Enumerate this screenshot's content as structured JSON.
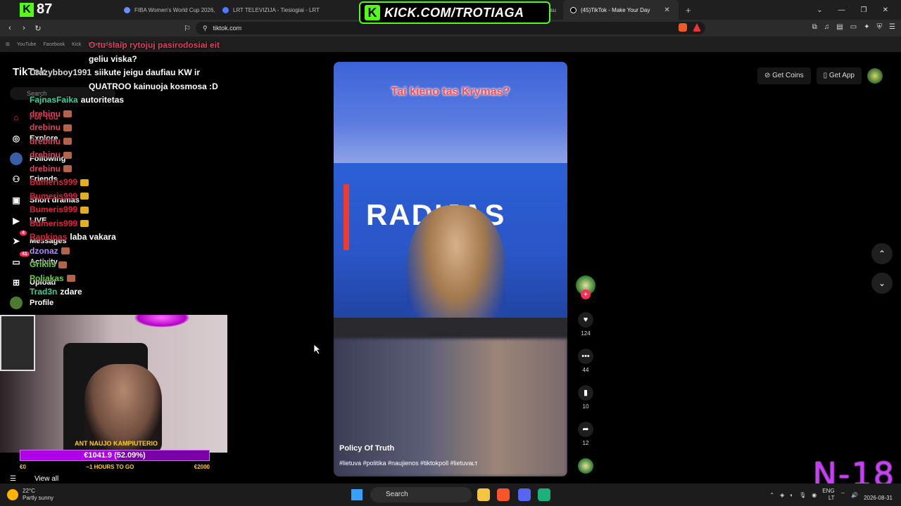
{
  "browser": {
    "tabs": [
      {
        "label": "FIBA Women's World Cup 2026, Bask",
        "active": false
      },
      {
        "label": "LRT TELEVIZIJA - Tiesiogiai - LRT",
        "active": false
      },
      {
        "label": "ir Aksesu",
        "active": false
      },
      {
        "label": "(45)TikTok - Make Your Day",
        "active": true
      }
    ],
    "url": "tiktok.com",
    "bookmarks": [
      "YouTube",
      "Facebook",
      "Kick",
      "Imported from Go"
    ]
  },
  "stream": {
    "viewer_count": "87",
    "kick_banner": "KICK.COM/TROTIAGA",
    "rating_label": "N-18",
    "goal": {
      "title": "ANT NAUJO KAMPIUTERIO",
      "amount": "€1041.9 (52.09%)",
      "progress_percent": 52.09,
      "start": "€0",
      "remaining": "~1 HOURS TO GO",
      "target": "€2000"
    },
    "chat": [
      {
        "user": "",
        "message": "O tu slaip rytojuj pasirodosiai eit",
        "color": "#e04060",
        "emote": "none"
      },
      {
        "user": "",
        "message": "geliu viska?",
        "color": "#ffffff",
        "emote": "none"
      },
      {
        "user": "Crazybboy1991",
        "message": "siikute jeigu daufiau KW ir",
        "color": "#dddddd",
        "emote": "none"
      },
      {
        "user": "",
        "message": "QUATROO kainuoja kosmosa :D",
        "color": "#ffffff",
        "emote": "none"
      },
      {
        "user": "FajnasFaika",
        "message": "autoritetas",
        "color": "#3ad1a0",
        "emote": "none"
      },
      {
        "user": "drebinu",
        "message": "",
        "color": "#e04060",
        "emote": "brown"
      },
      {
        "user": "drebinu",
        "message": "",
        "color": "#e04060",
        "emote": "brown"
      },
      {
        "user": "drebinu",
        "message": "",
        "color": "#e04060",
        "emote": "brown"
      },
      {
        "user": "drebinu",
        "message": "",
        "color": "#e04060",
        "emote": "brown"
      },
      {
        "user": "drebinu",
        "message": "",
        "color": "#e04060",
        "emote": "brown"
      },
      {
        "user": "Bumeris999",
        "message": "",
        "color": "#e0203a",
        "emote": "yellow"
      },
      {
        "user": "Bumeris999",
        "message": "",
        "color": "#e0203a",
        "emote": "yellow"
      },
      {
        "user": "Bumeris999",
        "message": "",
        "color": "#e0203a",
        "emote": "yellow"
      },
      {
        "user": "Bumeris999",
        "message": "",
        "color": "#e0203a",
        "emote": "yellow"
      },
      {
        "user": "Rapkinas",
        "message": "laba vakara",
        "color": "#e0203a",
        "emote": "none"
      },
      {
        "user": "dzonaz",
        "message": "",
        "color": "#b08cff",
        "emote": "brown"
      },
      {
        "user": "Grikiis",
        "message": "",
        "color": "#6ad13a",
        "emote": "brown"
      },
      {
        "user": "Poliakas",
        "message": "",
        "color": "#6ad13a",
        "emote": "brown"
      },
      {
        "user": "Trad3n",
        "message": "zdare",
        "color": "#3ad1a0",
        "emote": "none"
      }
    ]
  },
  "tiktok": {
    "logo": "TikTok",
    "search_placeholder": "Search",
    "nav": [
      {
        "label": "For You",
        "icon": "home-icon",
        "active": true
      },
      {
        "label": "Explore",
        "icon": "compass-icon",
        "active": false
      },
      {
        "label": "Following",
        "icon": "following-avatar-icon",
        "active": false
      },
      {
        "label": "Friends",
        "icon": "friends-icon",
        "active": false
      },
      {
        "label": "Short dramas",
        "icon": "drama-icon",
        "active": false
      },
      {
        "label": "LIVE",
        "icon": "live-icon",
        "active": false
      },
      {
        "label": "Messages",
        "icon": "send-icon",
        "active": false,
        "badge": "4"
      },
      {
        "label": "Activity",
        "icon": "activity-icon",
        "active": false,
        "badge": "41"
      },
      {
        "label": "Upload",
        "icon": "upload-icon",
        "active": false
      },
      {
        "label": "Profile",
        "icon": "profile-avatar-icon",
        "active": false
      }
    ],
    "view_all": "View all",
    "get_coins": "Get Coins",
    "get_app": "Get App",
    "video": {
      "overlay_caption": "Tai kieno tas Krymas?",
      "scene_text": "RADIJAS",
      "author": "Policy Of Truth",
      "hashtags": "#lietuva #politika #naujienos #tiktokpoll #lietuvaʟᴛ",
      "likes": "124",
      "comments": "44",
      "saves": "10",
      "shares": "12"
    }
  },
  "taskbar": {
    "temperature": "22°C",
    "weather": "Partly sunny",
    "search": "Search",
    "lang": "ENG",
    "region": "LT",
    "date": "2026-08-31"
  }
}
